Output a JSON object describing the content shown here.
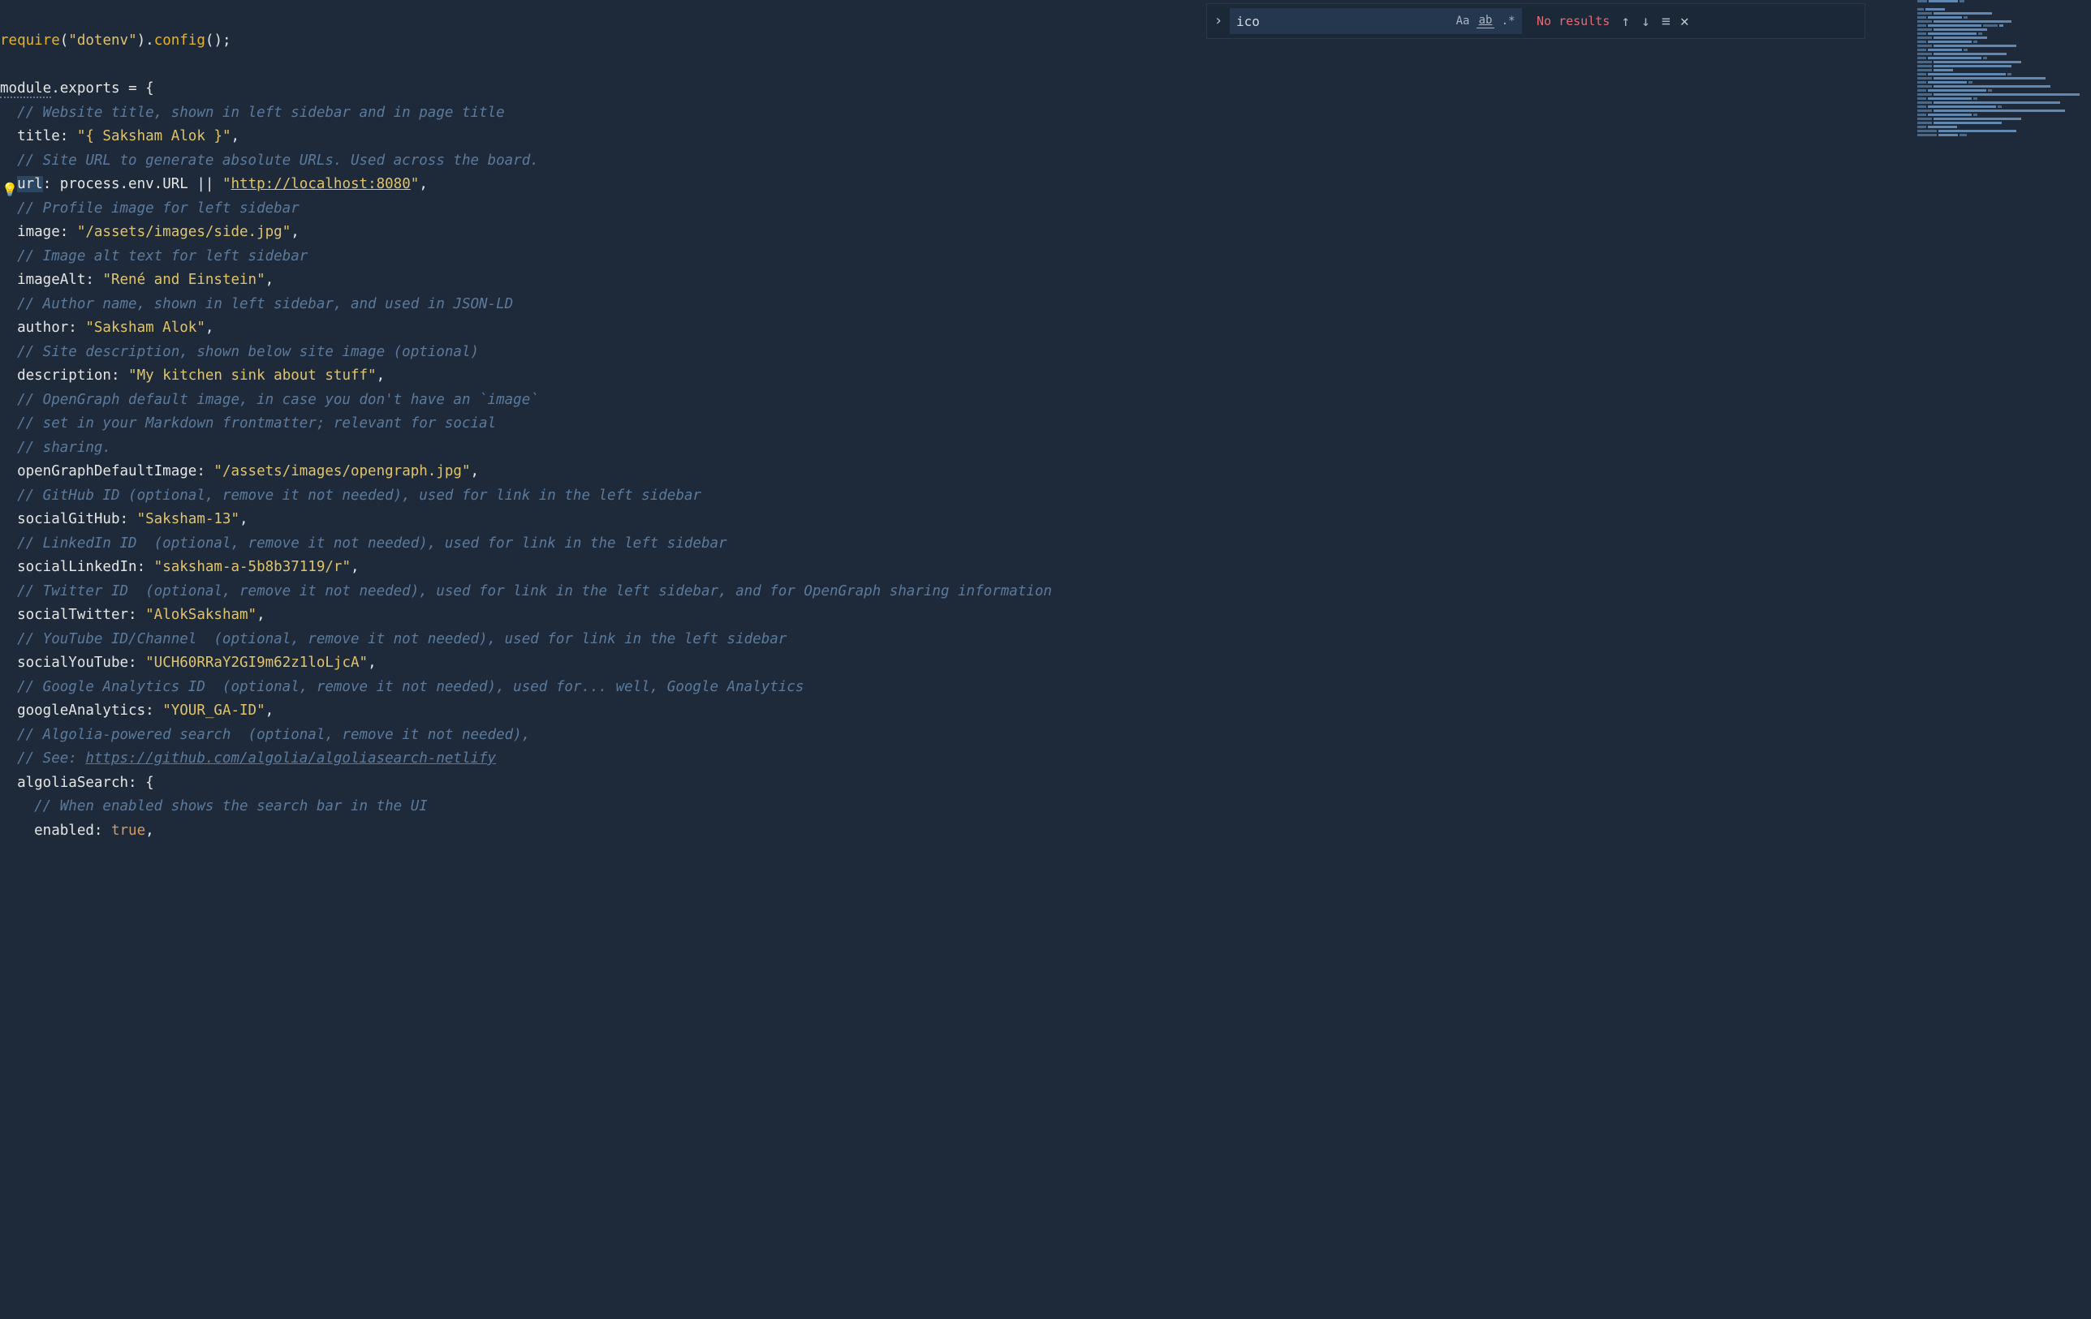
{
  "find": {
    "query": "ico",
    "results_text": "No results",
    "case_label": "Aa",
    "word_label": "ab",
    "regex_label": ".*"
  },
  "code": {
    "l1": {
      "a": "require",
      "b": "(",
      "c": "\"dotenv\"",
      "d": ")",
      "e": ".",
      "f": "config",
      "g": "();"
    },
    "l2": "",
    "l3": {
      "a": "module",
      "b": ".",
      "c": "exports",
      "d": " = {"
    },
    "l4": "  // Website title, shown in left sidebar and in page title",
    "l5": {
      "a": "  title: ",
      "b": "\"{ Saksham Alok }\"",
      "c": ","
    },
    "l6": "  // Site URL to generate absolute URLs. Used across the board.",
    "l7": {
      "a": "  ",
      "sel": "url",
      "b": ": process.env.URL || ",
      "c": "\"",
      "link": "http://localhost:8080",
      "d": "\"",
      "e": ","
    },
    "l8": "  // Profile image for left sidebar",
    "l9": {
      "a": "  image: ",
      "b": "\"/assets/images/side.jpg\"",
      "c": ","
    },
    "l10": "  // Image alt text for left sidebar",
    "l11": {
      "a": "  imageAlt: ",
      "b": "\"René and Einstein\"",
      "c": ","
    },
    "l12": "  // Author name, shown in left sidebar, and used in JSON-LD",
    "l13": {
      "a": "  author: ",
      "b": "\"Saksham Alok\"",
      "c": ","
    },
    "l14": "  // Site description, shown below site image (optional)",
    "l15": {
      "a": "  description: ",
      "b": "\"My kitchen sink about stuff\"",
      "c": ","
    },
    "l16": "  // OpenGraph default image, in case you don't have an `image`",
    "l17": "  // set in your Markdown frontmatter; relevant for social",
    "l18": "  // sharing.",
    "l19": {
      "a": "  openGraphDefaultImage: ",
      "b": "\"/assets/images/opengraph.jpg\"",
      "c": ","
    },
    "l20": "  // GitHub ID (optional, remove it not needed), used for link in the left sidebar",
    "l21": {
      "a": "  socialGitHub: ",
      "b": "\"Saksham-13\"",
      "c": ","
    },
    "l22": "  // LinkedIn ID  (optional, remove it not needed), used for link in the left sidebar",
    "l23": {
      "a": "  socialLinkedIn: ",
      "b": "\"saksham-a-5b8b37119/r\"",
      "c": ","
    },
    "l24": "  // Twitter ID  (optional, remove it not needed), used for link in the left sidebar, and for OpenGraph sharing information",
    "l25": {
      "a": "  socialTwitter: ",
      "b": "\"AlokSaksham\"",
      "c": ","
    },
    "l26": "  // YouTube ID/Channel  (optional, remove it not needed), used for link in the left sidebar",
    "l27": {
      "a": "  socialYouTube: ",
      "b": "\"UCH60RRaY2GI9m62z1loLjcA\"",
      "c": ","
    },
    "l28": "  // Google Analytics ID  (optional, remove it not needed), used for... well, Google Analytics",
    "l29": {
      "a": "  googleAnalytics: ",
      "b": "\"YOUR_GA-ID\"",
      "c": ","
    },
    "l30": "  // Algolia-powered search  (optional, remove it not needed),",
    "l31": {
      "a": "  // See: ",
      "link": "https://github.com/algolia/algoliasearch-netlify"
    },
    "l32": "  algoliaSearch: {",
    "l33": "    // When enabled shows the search bar in the UI",
    "l34": {
      "a": "    enabled: ",
      "b": "true",
      "c": ","
    }
  }
}
